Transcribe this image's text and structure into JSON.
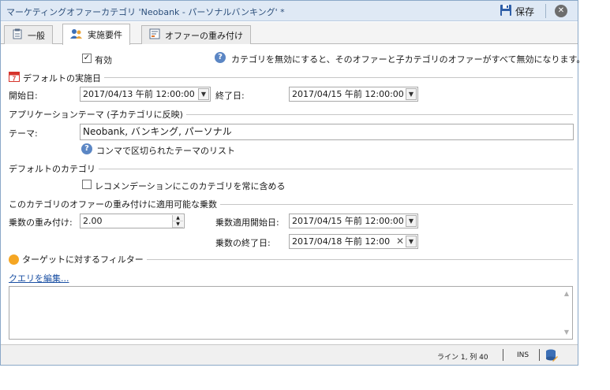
{
  "window": {
    "title": "マーケティングオファーカテゴリ 'Neobank - パーソナルバンキング' *",
    "save_label": "保存",
    "close_glyph": "✕"
  },
  "tabs": [
    {
      "label": "一般",
      "icon": "clipboard-icon",
      "active": false
    },
    {
      "label": "実施要件",
      "icon": "users-icon",
      "active": true
    },
    {
      "label": "オファーの重み付け",
      "icon": "weighting-icon",
      "active": false
    }
  ],
  "eligibility": {
    "enabled_label": "有効",
    "enabled_checked": true,
    "help_text": "カテゴリを無効にすると、そのオファーと子カテゴリのオファーがすべて無効になります。"
  },
  "default_dates": {
    "section_title": "デフォルトの実施日",
    "calendar_day": "7",
    "start_label": "開始日:",
    "start_value": "2017/04/13 午前 12:00:00",
    "end_label": "終了日:",
    "end_value": "2017/04/15 午前 12:00:00"
  },
  "themes": {
    "section_title": "アプリケーションテーマ (子カテゴリに反映)",
    "theme_label": "テーマ:",
    "theme_value": "Neobank, バンキング, パーソナル",
    "hint": "コンマで区切られたテーマのリスト"
  },
  "default_category": {
    "section_title": "デフォルトのカテゴリ",
    "always_include_label": "レコメンデーションにこのカテゴリを常に含める",
    "always_include_checked": false
  },
  "multiplier": {
    "section_title": "このカテゴリのオファーの重み付けに適用可能な乗数",
    "weight_label": "乗数の重み付け:",
    "weight_value": "2.00",
    "apply_start_label": "乗数適用開始日:",
    "apply_start_value": "2017/04/15 午前 12:00:00",
    "end_label": "乗数の終了日:",
    "end_value": "2017/04/18 午前 12:00"
  },
  "filter": {
    "section_title": "ターゲットに対するフィルター",
    "edit_query_link": "クエリを編集..."
  },
  "status": {
    "position": "ライン 1, 列 40",
    "mode": "INS"
  },
  "colors": {
    "title_text": "#2b4e7a",
    "link": "#1a4fa3",
    "filter_dot": "#f5a623",
    "calendar_red": "#d6342c",
    "help_blue": "#5b86c4"
  }
}
